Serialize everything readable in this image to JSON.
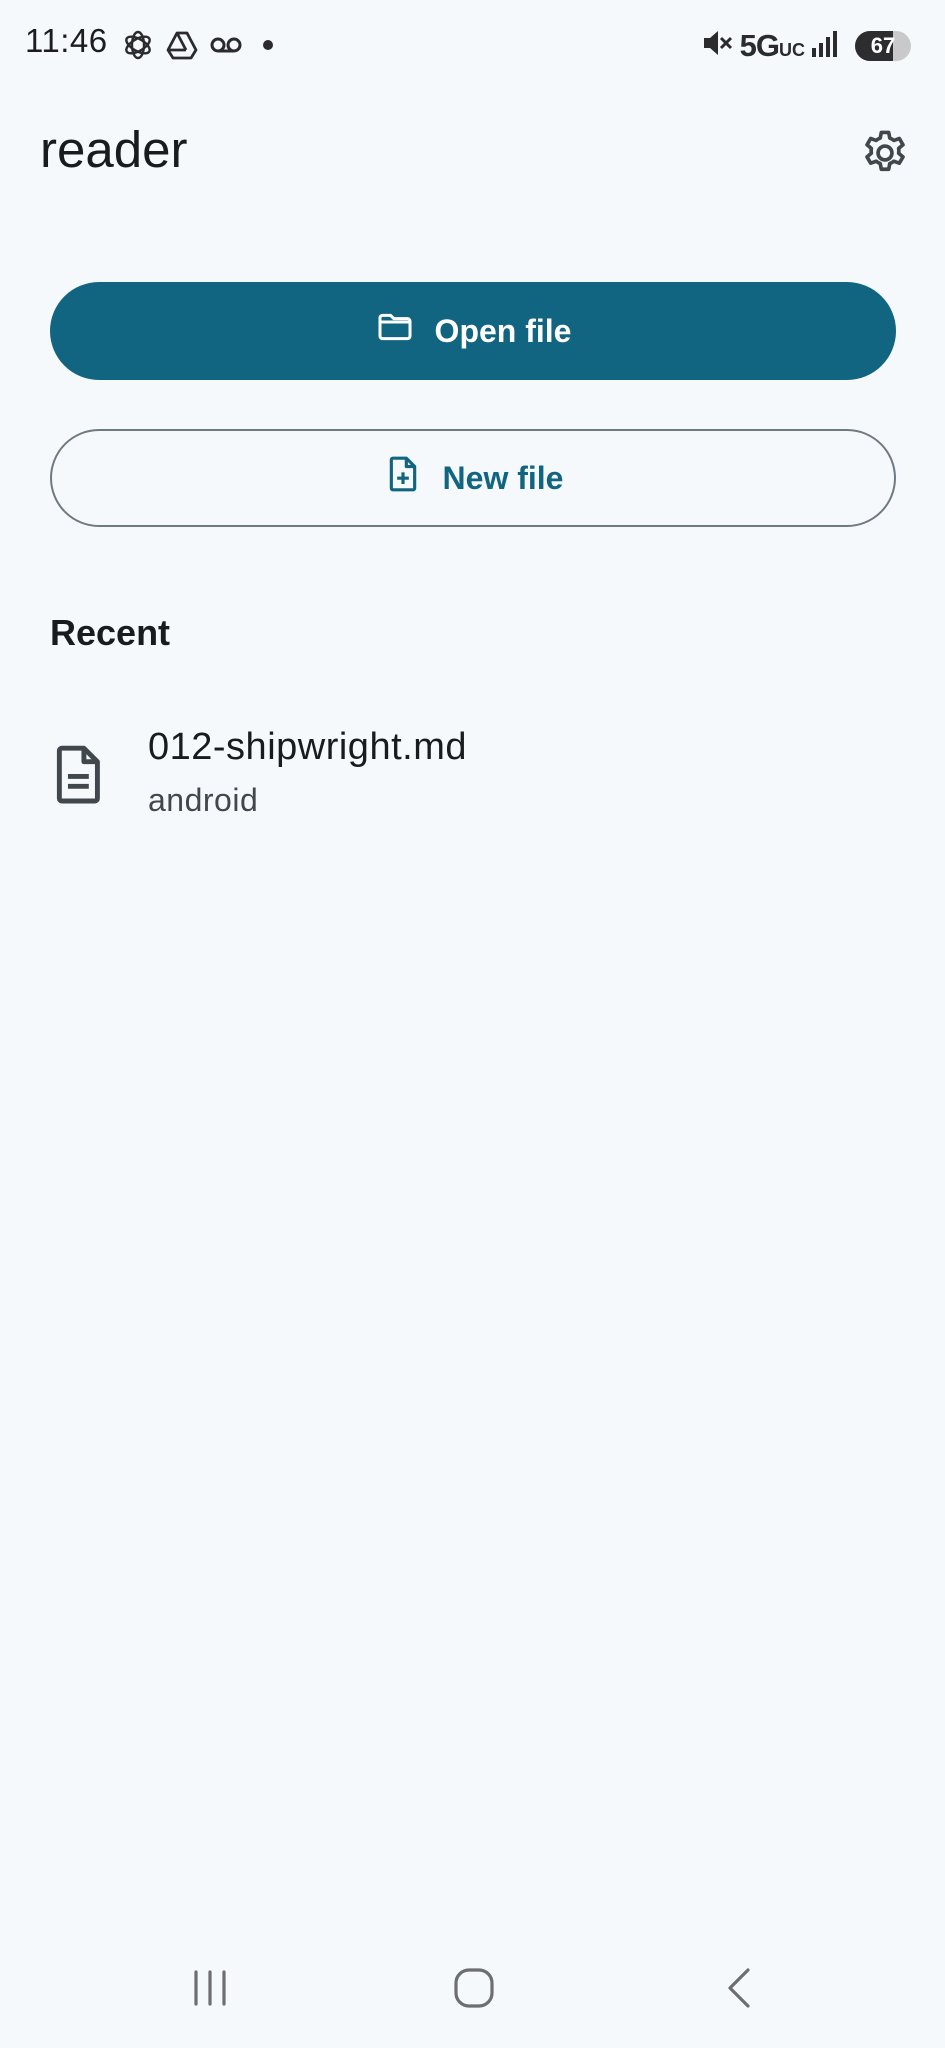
{
  "status_bar": {
    "time": "11:46",
    "network": "5G",
    "network_suffix": "UC",
    "battery": "67",
    "battery_level": 0.67,
    "left_icons": [
      "chatgpt-icon",
      "drive-icon",
      "voicemail-icon",
      "notification-dot-icon"
    ],
    "right_icons": [
      "mute-icon",
      "signal-icon",
      "battery-icon"
    ]
  },
  "app_bar": {
    "title": "reader",
    "settings_icon": "gear-icon"
  },
  "actions": {
    "open_file": {
      "label": "Open file",
      "icon": "folder-icon"
    },
    "new_file": {
      "label": "New file",
      "icon": "file-plus-icon"
    }
  },
  "recent": {
    "heading": "Recent",
    "items": [
      {
        "title": "012-shipwright.md",
        "subtitle": "android",
        "icon": "document-icon"
      }
    ]
  },
  "nav_bar": {
    "items": [
      "recents-icon",
      "home-icon",
      "back-icon"
    ]
  },
  "colors": {
    "primary": "#126581",
    "background": "#f6f9fc",
    "outline": "#6f7a80",
    "text": "#191c1e"
  }
}
